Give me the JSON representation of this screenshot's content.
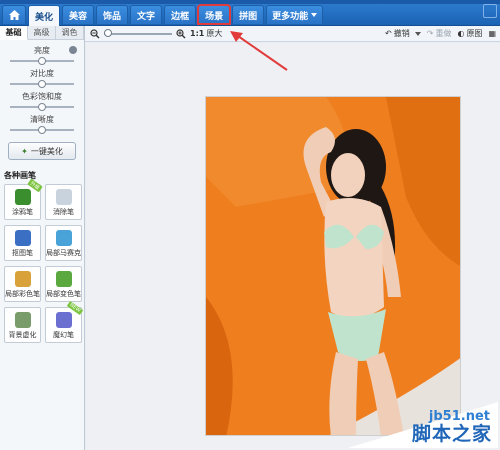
{
  "nav": {
    "tabs": [
      {
        "label": "美化"
      },
      {
        "label": "美容"
      },
      {
        "label": "饰品"
      },
      {
        "label": "文字"
      },
      {
        "label": "边框"
      },
      {
        "label": "场景"
      },
      {
        "label": "拼图"
      },
      {
        "label": "更多功能"
      }
    ]
  },
  "toolbar": {
    "zoom_ratio": "1:1",
    "zoom_fit": "原大",
    "undo": "撤销",
    "redo": "重做",
    "compare": "原图"
  },
  "panel": {
    "subtabs": [
      "基础",
      "高级",
      "调色"
    ],
    "sliders": [
      {
        "label": "亮度",
        "level": 0.5
      },
      {
        "label": "对比度",
        "level": 0.5
      },
      {
        "label": "色彩饱和度",
        "level": 0.5
      },
      {
        "label": "清晰度",
        "level": 0.5
      }
    ],
    "one_click": "一键美化",
    "brushes_title": "各种画笔",
    "brushes": [
      {
        "label": "涂鸦笔",
        "icon": "pen-icon",
        "color": "#3b8e2e",
        "badge": "升级"
      },
      {
        "label": "消除笔",
        "icon": "eraser-icon",
        "color": "#c9d3de"
      },
      {
        "label": "抠图笔",
        "icon": "cutout-icon",
        "color": "#3a6fc4"
      },
      {
        "label": "局部马赛克",
        "icon": "mosaic-icon",
        "color": "#4aa3d8"
      },
      {
        "label": "局部彩色笔",
        "icon": "color-brush-icon",
        "color": "#d9a13a"
      },
      {
        "label": "局部变色笔",
        "icon": "recolor-icon",
        "color": "#5aa83e"
      },
      {
        "label": "背景虚化",
        "icon": "blur-icon",
        "color": "#7a9c6a"
      },
      {
        "label": "魔幻笔",
        "icon": "magic-wand-icon",
        "color": "#6a6fd0",
        "badge": "NEW"
      }
    ]
  },
  "watermark": {
    "site": "jb51.net",
    "brand": "脚本之家"
  }
}
